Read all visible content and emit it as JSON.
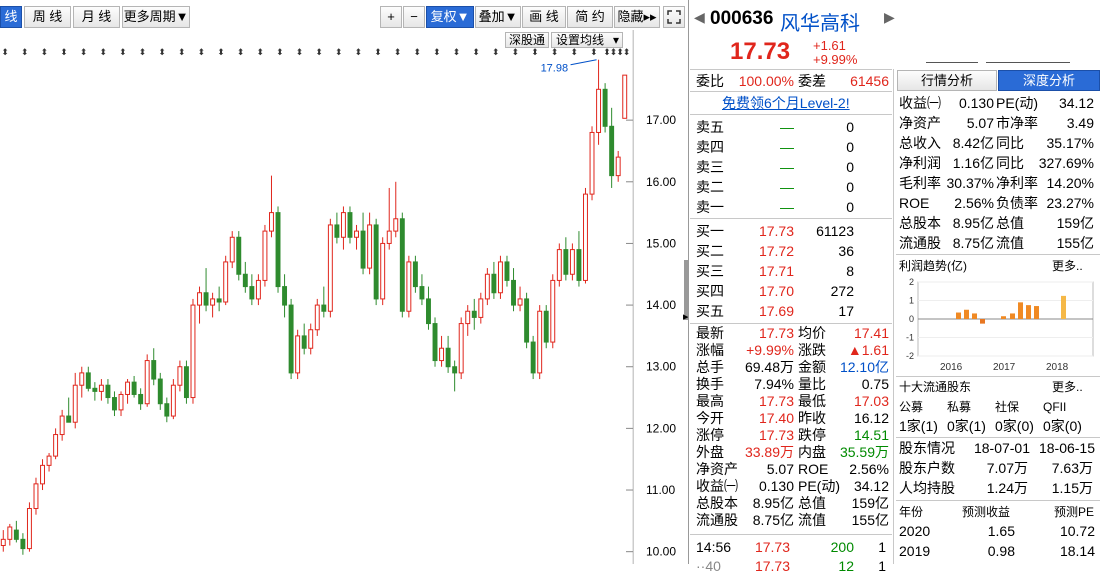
{
  "colors": {
    "up": "#e0261c",
    "down": "#2e8b2e",
    "accent": "#2a6bd6",
    "link": "#0050c8"
  },
  "toolbar": {
    "periods": [
      "线",
      "周 线",
      "月 线",
      "更多周期▼"
    ],
    "right": [
      {
        "label": "+"
      },
      {
        "label": "−"
      },
      {
        "label": "复权▼"
      },
      {
        "label": "叠加▼"
      },
      {
        "label": "画 线"
      },
      {
        "label": "简 约"
      },
      {
        "label": "隐藏▸▸"
      }
    ],
    "fullscreen_icon": "expand-icon"
  },
  "chart_buttons": {
    "depth": "深股通",
    "ma": "设置均线",
    "ma_arrow": "▾"
  },
  "chart_data": {
    "type": "candlestick",
    "ylim": [
      9.8,
      18.3
    ],
    "yticks": [
      "17.00",
      "16.00",
      "15.00",
      "14.00",
      "13.00",
      "12.00",
      "11.00",
      "10.00"
    ],
    "max_label": "17.98",
    "candles": [
      [
        10.1,
        10.35,
        10.0,
        10.2
      ],
      [
        10.2,
        10.45,
        10.1,
        10.4
      ],
      [
        10.35,
        10.5,
        10.15,
        10.2
      ],
      [
        10.2,
        10.3,
        9.95,
        10.05
      ],
      [
        10.05,
        10.8,
        10.0,
        10.7
      ],
      [
        10.7,
        11.2,
        10.6,
        11.1
      ],
      [
        11.1,
        11.5,
        11.0,
        11.4
      ],
      [
        11.4,
        11.6,
        11.3,
        11.55
      ],
      [
        11.55,
        12.0,
        11.5,
        11.9
      ],
      [
        11.9,
        12.3,
        11.8,
        12.2
      ],
      [
        12.2,
        12.5,
        12.1,
        12.1
      ],
      [
        12.1,
        12.9,
        12.0,
        12.7
      ],
      [
        12.7,
        13.0,
        12.5,
        12.9
      ],
      [
        12.9,
        13.0,
        12.6,
        12.65
      ],
      [
        12.65,
        12.75,
        12.45,
        12.6
      ],
      [
        12.6,
        12.8,
        12.45,
        12.7
      ],
      [
        12.7,
        12.8,
        12.4,
        12.5
      ],
      [
        12.5,
        12.6,
        12.2,
        12.3
      ],
      [
        12.3,
        12.6,
        12.2,
        12.55
      ],
      [
        12.55,
        12.8,
        12.4,
        12.75
      ],
      [
        12.75,
        12.85,
        12.5,
        12.55
      ],
      [
        12.55,
        12.65,
        12.3,
        12.4
      ],
      [
        12.4,
        13.2,
        12.35,
        13.1
      ],
      [
        13.1,
        13.3,
        12.7,
        12.8
      ],
      [
        12.8,
        12.9,
        12.3,
        12.4
      ],
      [
        12.4,
        12.5,
        12.1,
        12.2
      ],
      [
        12.2,
        12.8,
        12.15,
        12.7
      ],
      [
        12.7,
        13.1,
        12.6,
        13.0
      ],
      [
        13.0,
        13.1,
        12.4,
        12.5
      ],
      [
        12.5,
        14.1,
        12.4,
        14.0
      ],
      [
        14.0,
        14.3,
        13.7,
        14.2
      ],
      [
        14.2,
        14.6,
        13.9,
        14.0
      ],
      [
        14.0,
        14.2,
        13.8,
        14.1
      ],
      [
        14.1,
        14.3,
        13.9,
        14.05
      ],
      [
        14.05,
        14.8,
        14.0,
        14.7
      ],
      [
        14.7,
        15.2,
        14.6,
        15.1
      ],
      [
        15.1,
        15.2,
        14.4,
        14.5
      ],
      [
        14.5,
        14.7,
        14.2,
        14.3
      ],
      [
        14.3,
        14.5,
        14.0,
        14.1
      ],
      [
        14.1,
        14.5,
        14.0,
        14.4
      ],
      [
        14.4,
        15.3,
        14.3,
        15.2
      ],
      [
        15.2,
        16.1,
        15.1,
        15.5
      ],
      [
        15.5,
        15.6,
        14.2,
        14.3
      ],
      [
        14.3,
        14.5,
        13.8,
        14.0
      ],
      [
        14.0,
        14.1,
        12.8,
        12.9
      ],
      [
        12.9,
        13.6,
        12.8,
        13.5
      ],
      [
        13.5,
        13.7,
        13.2,
        13.3
      ],
      [
        13.3,
        13.7,
        13.2,
        13.6
      ],
      [
        13.6,
        14.1,
        13.5,
        14.0
      ],
      [
        14.0,
        14.3,
        13.8,
        13.9
      ],
      [
        13.9,
        15.4,
        13.8,
        15.3
      ],
      [
        15.3,
        15.5,
        15.0,
        15.1
      ],
      [
        15.1,
        15.6,
        14.9,
        15.5
      ],
      [
        15.5,
        15.6,
        15.0,
        15.1
      ],
      [
        15.1,
        15.3,
        14.9,
        15.2
      ],
      [
        15.2,
        15.5,
        14.5,
        14.6
      ],
      [
        14.6,
        15.5,
        14.5,
        15.3
      ],
      [
        15.3,
        15.4,
        14.0,
        14.1
      ],
      [
        14.1,
        15.1,
        14.0,
        15.0
      ],
      [
        15.0,
        15.9,
        14.9,
        15.2
      ],
      [
        15.2,
        16.0,
        15.1,
        15.4
      ],
      [
        15.4,
        15.5,
        13.8,
        13.9
      ],
      [
        13.9,
        14.8,
        13.8,
        14.7
      ],
      [
        14.7,
        14.8,
        14.2,
        14.3
      ],
      [
        14.3,
        14.5,
        14.0,
        14.1
      ],
      [
        14.1,
        14.3,
        13.6,
        13.7
      ],
      [
        13.7,
        13.8,
        13.0,
        13.1
      ],
      [
        13.1,
        13.5,
        13.0,
        13.3
      ],
      [
        13.3,
        13.5,
        12.9,
        13.0
      ],
      [
        13.0,
        13.1,
        12.6,
        12.9
      ],
      [
        12.9,
        13.8,
        12.8,
        13.7
      ],
      [
        13.7,
        14.0,
        13.5,
        13.9
      ],
      [
        13.9,
        14.1,
        13.6,
        13.8
      ],
      [
        13.8,
        14.2,
        13.7,
        14.1
      ],
      [
        14.1,
        14.6,
        14.0,
        14.5
      ],
      [
        14.5,
        14.7,
        14.1,
        14.2
      ],
      [
        14.2,
        14.8,
        14.1,
        14.7
      ],
      [
        14.7,
        14.8,
        14.3,
        14.4
      ],
      [
        14.4,
        14.6,
        13.9,
        14.0
      ],
      [
        14.0,
        14.3,
        13.9,
        14.1
      ],
      [
        14.1,
        14.2,
        13.3,
        13.4
      ],
      [
        13.4,
        13.5,
        12.8,
        12.9
      ],
      [
        12.9,
        14.0,
        12.8,
        13.9
      ],
      [
        13.9,
        14.0,
        13.3,
        13.4
      ],
      [
        13.4,
        14.5,
        13.3,
        14.4
      ],
      [
        14.4,
        15.0,
        14.3,
        14.9
      ],
      [
        14.9,
        15.1,
        14.4,
        14.5
      ],
      [
        14.5,
        15.0,
        14.4,
        14.9
      ],
      [
        14.9,
        15.2,
        14.3,
        14.4
      ],
      [
        14.4,
        15.9,
        14.35,
        15.8
      ],
      [
        15.8,
        16.9,
        15.7,
        16.8
      ],
      [
        16.8,
        17.98,
        16.6,
        17.5
      ],
      [
        17.5,
        17.6,
        16.8,
        16.9
      ],
      [
        16.9,
        17.2,
        15.9,
        16.1
      ],
      [
        16.1,
        16.5,
        16.0,
        16.4
      ],
      [
        17.03,
        17.73,
        17.03,
        17.73
      ]
    ]
  },
  "quote": {
    "code": "000636",
    "name": "风华高科",
    "price": "17.73",
    "change": "+1.61",
    "change_pct": "+9.99%",
    "weibi_label": "委比",
    "weibi": "100.00%",
    "weicha_label": "委差",
    "weicha": "61456",
    "promo": "免费领6个月Level-2!",
    "sell": [
      {
        "label": "卖五",
        "price": "—",
        "vol": "0"
      },
      {
        "label": "卖四",
        "price": "—",
        "vol": "0"
      },
      {
        "label": "卖三",
        "price": "—",
        "vol": "0"
      },
      {
        "label": "卖二",
        "price": "—",
        "vol": "0"
      },
      {
        "label": "卖一",
        "price": "—",
        "vol": "0"
      }
    ],
    "buy": [
      {
        "label": "买一",
        "price": "17.73",
        "vol": "61123"
      },
      {
        "label": "买二",
        "price": "17.72",
        "vol": "36"
      },
      {
        "label": "买三",
        "price": "17.71",
        "vol": "8"
      },
      {
        "label": "买四",
        "price": "17.70",
        "vol": "272"
      },
      {
        "label": "买五",
        "price": "17.69",
        "vol": "17"
      }
    ],
    "stats": [
      {
        "l1": "最新",
        "v1": "17.73",
        "c1": "red",
        "l2": "均价",
        "v2": "17.41",
        "c2": "red"
      },
      {
        "l1": "涨幅",
        "v1": "+9.99%",
        "c1": "red",
        "l2": "涨跌",
        "v2": "▲1.61",
        "c2": "red"
      },
      {
        "l1": "总手",
        "v1": "69.48万",
        "c1": "",
        "l2": "金额",
        "v2": "12.10亿",
        "c2": "blu"
      },
      {
        "l1": "换手",
        "v1": "7.94%",
        "c1": "",
        "l2": "量比",
        "v2": "0.75",
        "c2": ""
      },
      {
        "l1": "最高",
        "v1": "17.73",
        "c1": "red",
        "l2": "最低",
        "v2": "17.03",
        "c2": "red"
      },
      {
        "l1": "今开",
        "v1": "17.40",
        "c1": "red",
        "l2": "昨收",
        "v2": "16.12",
        "c2": ""
      },
      {
        "l1": "涨停",
        "v1": "17.73",
        "c1": "red",
        "l2": "跌停",
        "v2": "14.51",
        "c2": "grn"
      },
      {
        "l1": "外盘",
        "v1": "33.89万",
        "c1": "red",
        "l2": "内盘",
        "v2": "35.59万",
        "c2": "grn"
      },
      {
        "l1": "净资产",
        "v1": "5.07",
        "c1": "",
        "l2": "ROE",
        "v2": "2.56%",
        "c2": ""
      },
      {
        "l1": "收益㈠",
        "v1": "0.130",
        "c1": "",
        "l2": "PE(动)",
        "v2": "34.12",
        "c2": ""
      },
      {
        "l1": "总股本",
        "v1": "8.95亿",
        "c1": "",
        "l2": "总值",
        "v2": "159亿",
        "c2": ""
      },
      {
        "l1": "流通股",
        "v1": "8.75亿",
        "c1": "",
        "l2": "流值",
        "v2": "155亿",
        "c2": ""
      }
    ],
    "tick": {
      "time": "14:56",
      "price": "17.73",
      "vol": "200",
      "n": "1"
    },
    "tick2": {
      "time": "··40",
      "price": "17.73",
      "vol": "12",
      "n": "1"
    }
  },
  "right": {
    "tabs": [
      "行情分析",
      "深度分析"
    ],
    "fin": [
      {
        "l1": "收益㈠",
        "v1": "0.130",
        "l2": "PE(动)",
        "v2": "34.12"
      },
      {
        "l1": "净资产",
        "v1": "5.07",
        "l2": "市净率",
        "v2": "3.49"
      },
      {
        "l1": "总收入",
        "v1": "8.42亿",
        "l2": "同比",
        "v2": "35.17%"
      },
      {
        "l1": "净利润",
        "v1": "1.16亿",
        "l2": "同比",
        "v2": "327.69%"
      },
      {
        "l1": "毛利率",
        "v1": "30.37%",
        "l2": "净利率",
        "v2": "14.20%"
      },
      {
        "l1": "ROE",
        "v1": "2.56%",
        "l2": "负债率",
        "v2": "23.27%"
      },
      {
        "l1": "总股本",
        "v1": "8.95亿",
        "l2": "总值",
        "v2": "159亿"
      },
      {
        "l1": "流通股",
        "v1": "8.75亿",
        "l2": "流值",
        "v2": "155亿"
      }
    ],
    "profit_title": "利润趋势(亿)",
    "more": "更多..",
    "profit_chart": {
      "ylim": [
        -2,
        2
      ],
      "yticks": [
        "2",
        "1",
        "0",
        "-1",
        "-2"
      ],
      "xlabels": [
        "2016",
        "2017",
        "2018"
      ],
      "bars": [
        0.35,
        0.5,
        0.3,
        -0.25,
        0.15,
        0.3,
        0.9,
        0.75,
        0.7,
        1.25
      ]
    },
    "holders_title": "十大流通股东",
    "holders_more": "更多..",
    "holder_types": [
      "公募",
      "私募",
      "社保",
      "QFII"
    ],
    "holder_counts": [
      "1家(1)",
      "0家(1)",
      "0家(0)",
      "0家(0)"
    ],
    "sh_head": {
      "label": "股东情况",
      "d1": "18-07-01",
      "d2": "18-06-15"
    },
    "sh_rows": [
      {
        "label": "股东户数",
        "v1": "7.07万",
        "v2": "7.63万"
      },
      {
        "label": "人均持股",
        "v1": "1.24万",
        "v2": "1.15万"
      }
    ],
    "fc_head": {
      "year": "年份",
      "eps": "预测收益",
      "pe": "预测PE"
    },
    "forecast": [
      {
        "year": "2020",
        "eps": "1.65",
        "pe": "10.72"
      },
      {
        "year": "2019",
        "eps": "0.98",
        "pe": "18.14"
      }
    ]
  }
}
